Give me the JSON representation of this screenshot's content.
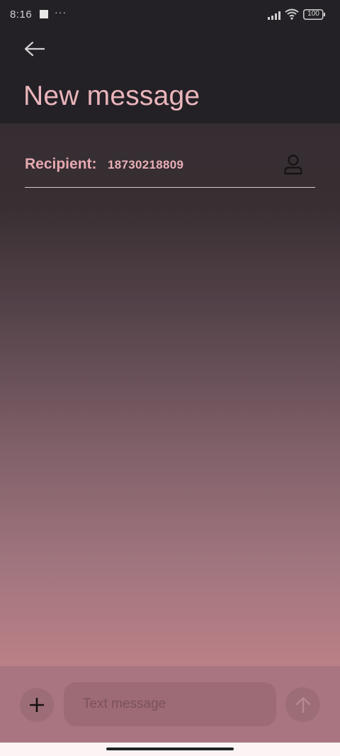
{
  "status_bar": {
    "time": "8:16",
    "notification_square": "media-icon",
    "overflow": "···",
    "signal": "signal-icon",
    "wifi": "wifi-icon",
    "battery": "100"
  },
  "header": {
    "back_icon": "back-arrow-icon",
    "title": "New message"
  },
  "recipient": {
    "label": "Recipient:",
    "value": "18730218809",
    "contact_icon": "contact-person-icon"
  },
  "composer": {
    "attach_icon": "plus-icon",
    "input_value": "",
    "placeholder": "Text message",
    "send_icon": "send-arrow-icon"
  },
  "colors": {
    "title_pink": "#eab5bc",
    "recipient_pink": "#e6a9b1",
    "header_bg": "#232125",
    "composer_bg": "#a97580"
  }
}
